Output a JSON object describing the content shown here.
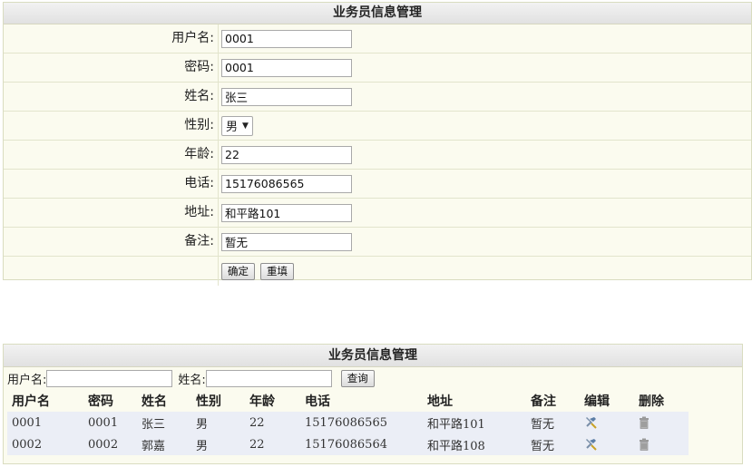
{
  "form": {
    "title": "业务员信息管理",
    "fields": {
      "username": {
        "label": "用户名:",
        "value": "0001"
      },
      "password": {
        "label": "密码:",
        "value": "0001"
      },
      "name": {
        "label": "姓名:",
        "value": "张三"
      },
      "gender": {
        "label": "性别:",
        "value": "男"
      },
      "age": {
        "label": "年龄:",
        "value": "22"
      },
      "phone": {
        "label": "电话:",
        "value": "15176086565"
      },
      "address": {
        "label": "地址:",
        "value": "和平路101"
      },
      "remark": {
        "label": "备注:",
        "value": "暂无"
      }
    },
    "confirm_label": "确定",
    "reset_label": "重填"
  },
  "list": {
    "title": "业务员信息管理",
    "search": {
      "username_label": "用户名:",
      "username_value": "",
      "name_label": "姓名:",
      "name_value": "",
      "query_label": "查询"
    },
    "columns": [
      "用户名",
      "密码",
      "姓名",
      "性别",
      "年龄",
      "电话",
      "地址",
      "备注",
      "编辑",
      "删除"
    ],
    "rows": [
      {
        "username": "0001",
        "password": "0001",
        "name": "张三",
        "gender": "男",
        "age": "22",
        "phone": "15176086565",
        "address": "和平路101",
        "remark": "暂无"
      },
      {
        "username": "0002",
        "password": "0002",
        "name": "郭嘉",
        "gender": "男",
        "age": "22",
        "phone": "15176086564",
        "address": "和平路108",
        "remark": "暂无"
      }
    ],
    "edit_icon": "edit-tools-icon",
    "delete_icon": "trash-can-icon"
  }
}
